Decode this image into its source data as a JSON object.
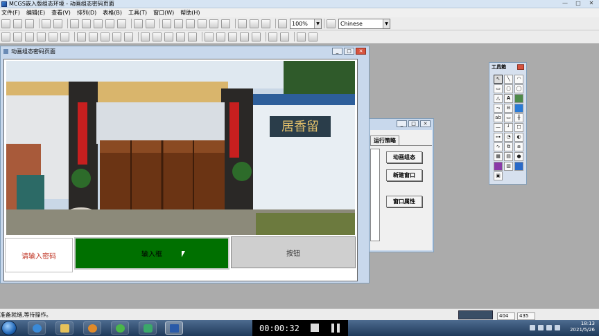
{
  "app": {
    "title": "MCGS嵌入版组态环境 - 动画组态密码页面"
  },
  "menu": [
    "文件(F)",
    "编辑(E)",
    "查看(V)",
    "排列(D)",
    "表格(B)",
    "工具(T)",
    "窗口(W)",
    "帮助(H)"
  ],
  "toolbar": {
    "zoom_value": "100%",
    "language_value": "Chinese"
  },
  "strategy_window": {
    "tab_label": "运行策略",
    "buttons": [
      "动画组态",
      "新建窗口",
      "窗口属性"
    ]
  },
  "anim_window": {
    "title": "动画组态密码页面",
    "prompt_label": "请输入密码",
    "input_label": "输入框",
    "button_label": "按钮",
    "photo_sign": "居香留"
  },
  "toolbox": {
    "title": "工具箱",
    "tools": [
      "pointer",
      "line",
      "arc",
      "rect",
      "rounded-rect",
      "ellipse",
      "poly",
      "text-A",
      "bitmap",
      "flow",
      "pipe",
      "label",
      "input-ab",
      "button",
      "slider",
      "hline",
      "vline",
      "check",
      "scale",
      "gauge",
      "meter",
      "trend",
      "chart",
      "alarm",
      "grid",
      "table",
      "edit",
      "bar",
      "report",
      "list",
      "window"
    ]
  },
  "statusbar": {
    "message": "准备就绪,等待操作。",
    "coord_x": "404",
    "coord_y": "435"
  },
  "recorder": {
    "time": "00:00:32"
  },
  "taskbar": {
    "clock_time": "18:13",
    "clock_date": "2021/5/26"
  }
}
